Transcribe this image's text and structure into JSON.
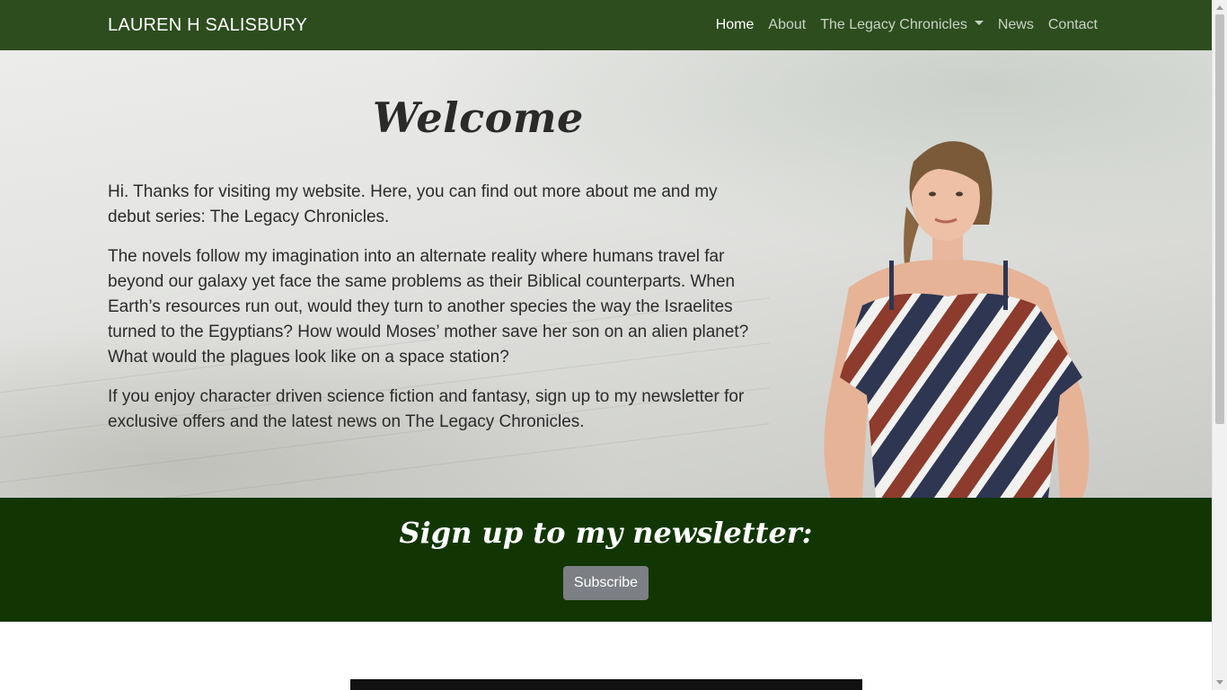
{
  "navbar": {
    "brand": "LAUREN H SALISBURY",
    "links": [
      {
        "label": "Home",
        "active": true
      },
      {
        "label": "About",
        "active": false
      },
      {
        "label": "The Legacy Chronicles",
        "active": false,
        "dropdown": true
      },
      {
        "label": "News",
        "active": false
      },
      {
        "label": "Contact",
        "active": false
      }
    ]
  },
  "hero": {
    "title": "Welcome",
    "paragraphs": [
      "Hi. Thanks for visiting my website. Here, you can find out more about me and my debut series: The Legacy Chronicles.",
      "The novels follow my imagination into an alternate reality where humans travel far beyond our galaxy yet face the same problems as their Biblical counterparts. When Earth’s resources run out, would they turn to another species the way the Israelites turned to the Egyptians? How would Moses’ mother save her son on an alien planet? What would the plagues look like on a space station?",
      "If you enjoy character driven science fiction and fantasy, sign up to my newsletter for exclusive offers and the latest news on The Legacy Chronicles."
    ]
  },
  "newsletter": {
    "title": "Sign up to my newsletter:",
    "button_label": "Subscribe"
  },
  "colors": {
    "navbar_bg": "#2d4d1e",
    "newsletter_bg": "#123603",
    "button_bg": "#7c7f84"
  }
}
